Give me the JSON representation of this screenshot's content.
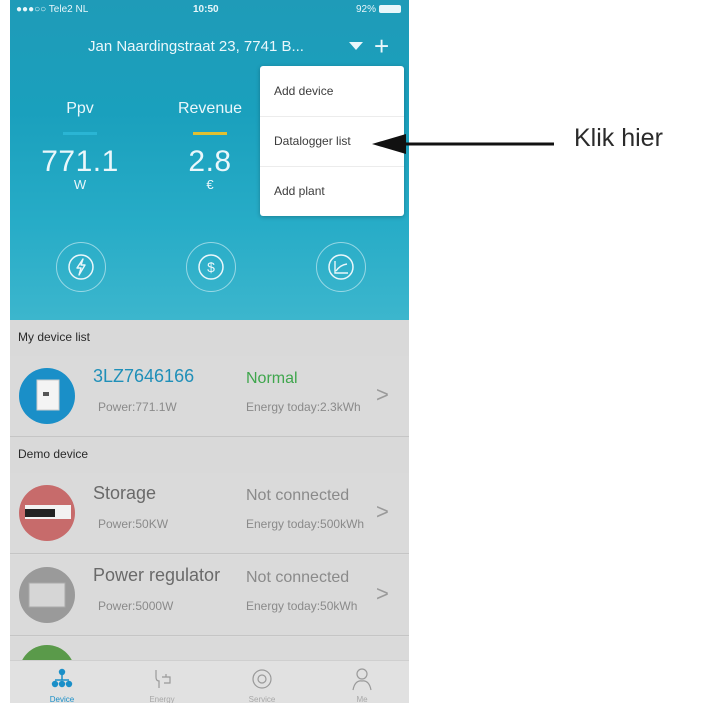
{
  "status_bar": {
    "carrier": "●●●○○ Tele2 NL",
    "time": "10:50",
    "battery": "92%"
  },
  "header": {
    "address": "Jan Naardingstraat 23, 7741 B..."
  },
  "stats": [
    {
      "label": "Ppv",
      "value": "771.1",
      "unit": "W",
      "icon": "lightning-icon",
      "bar_color": "#2ab5d4"
    },
    {
      "label": "Revenue",
      "value": "2.8",
      "unit": "€",
      "icon": "dollar-icon",
      "bar_color": "#e0c030"
    },
    {
      "label": "",
      "value": "",
      "unit": "",
      "icon": "chart-icon"
    }
  ],
  "menu": {
    "items": [
      {
        "label": "Add device"
      },
      {
        "label": "Datalogger list"
      },
      {
        "label": "Add plant"
      }
    ]
  },
  "my_devices": {
    "title": "My device list",
    "items": [
      {
        "name": "3LZ7646166",
        "power": "Power:771.1W",
        "status": "Normal",
        "energy": "Energy today:2.3kWh",
        "name_color": "#1f8fb8",
        "status_color": "#3fa64d"
      }
    ]
  },
  "demo_devices": {
    "title": "Demo device",
    "items": [
      {
        "name": "Storage",
        "power": "Power:50KW",
        "status": "Not connected",
        "energy": "Energy today:500kWh"
      },
      {
        "name": "Power regulator",
        "power": "Power:5000W",
        "status": "Not connected",
        "energy": "Energy today:50kWh"
      }
    ]
  },
  "tabbar": {
    "tabs": [
      {
        "label": "Device",
        "icon": "device-network-icon"
      },
      {
        "label": "Energy",
        "icon": "energy-plug-icon"
      },
      {
        "label": "Service",
        "icon": "service-icon"
      },
      {
        "label": "Me",
        "icon": "person-icon"
      }
    ]
  },
  "annotation": {
    "text": "Klik hier"
  },
  "colors": {
    "header_teal": "#1f9bb8",
    "accent_blue": "#1a8fc8"
  }
}
